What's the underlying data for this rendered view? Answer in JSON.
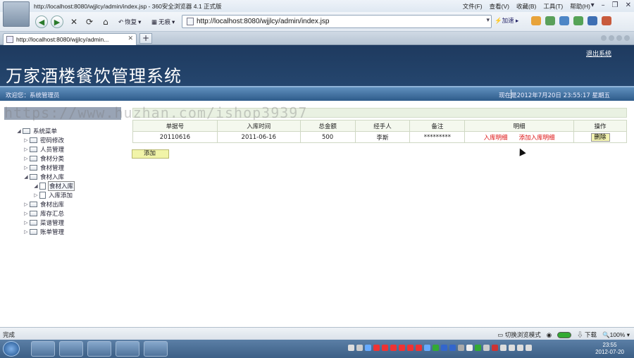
{
  "browser": {
    "title": "http://localhost:8080/wjjlcy/admin/index.jsp - 360安全浏览器 4.1 正式版",
    "menu": [
      "文件(F)",
      "查看(V)",
      "收藏(B)",
      "工具(T)",
      "帮助(H)"
    ],
    "back_label": "恢复",
    "trace_label": "无痕",
    "url": "http://localhost:8080/wjjlcy/admin/index.jsp",
    "accel_label": "加速",
    "tab_title": "http://localhost:8080/wjjlcy/admin..."
  },
  "header": {
    "logout": "退出系统",
    "system_title": "万家酒楼餐饮管理系统",
    "welcome": "欢迎您：系统管理员",
    "datetime": "现在是2012年7月20日  23:55:17 星期五"
  },
  "watermark": "https://www.huzhan.com/ishop39397",
  "tree": {
    "root": "系统菜单",
    "items": [
      {
        "label": "密码修改",
        "expanded": false
      },
      {
        "label": "人员管理",
        "expanded": false
      },
      {
        "label": "食材分类",
        "expanded": false
      },
      {
        "label": "食材管理",
        "expanded": false
      },
      {
        "label": "食材入库",
        "expanded": true,
        "children": [
          "食材入库",
          "入库添加"
        ]
      },
      {
        "label": "食材出库",
        "expanded": false
      },
      {
        "label": "库存汇总",
        "expanded": false
      },
      {
        "label": "菜谱管理",
        "expanded": false
      },
      {
        "label": "账单管理",
        "expanded": false
      }
    ]
  },
  "table": {
    "headers": [
      "单据号",
      "入库时间",
      "总金额",
      "经手人",
      "备注",
      "明细",
      "操作"
    ],
    "rows": [
      {
        "id": "20110616",
        "date": "2011-06-16",
        "amount": "500",
        "handler": "李斯",
        "note": "*********",
        "detail_link": "入库明细",
        "add_detail_link": "添加入库明细",
        "delete": "删除"
      }
    ]
  },
  "add_button": "添加",
  "statusbar": {
    "left": "完成",
    "mode": "切换浏览模式",
    "download": "下载",
    "zoom": "100%"
  },
  "taskbar": {
    "time": "23:55",
    "date": "2012-07-20"
  }
}
